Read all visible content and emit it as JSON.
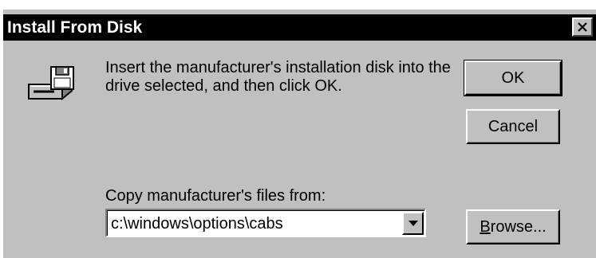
{
  "dialog": {
    "title": "Install From Disk",
    "message": "Insert the manufacturer's installation disk into the drive selected, and then click OK.",
    "buttons": {
      "ok": "OK",
      "cancel": "Cancel",
      "browse_mnemonic": "B",
      "browse_rest": "rowse..."
    },
    "copy_from": {
      "label": "Copy manufacturer's files from:",
      "value": "c:\\windows\\options\\cabs"
    },
    "icons": {
      "close": "close-icon",
      "disk": "floppy-drive-icon",
      "dropdown": "chevron-down-icon"
    }
  },
  "colors": {
    "face": "#c0c0c0",
    "titlebar": "#000000",
    "titletext": "#ffffff"
  }
}
